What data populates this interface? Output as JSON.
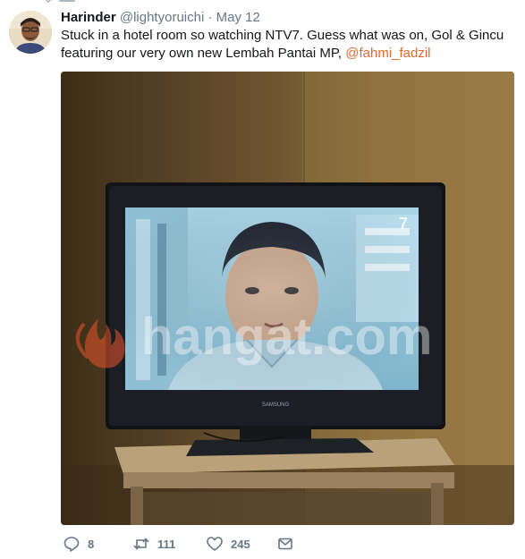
{
  "tweet": {
    "display_name": "Harinder",
    "handle": "@lightyoruichi",
    "separator": "·",
    "date": "May 12",
    "text": "Stuck in a hotel room so watching NTV7. Guess what was on, Gol & Gincu featuring our very own new Lembah Pantai MP, ",
    "mention": "@fahmi_fadzil"
  },
  "media": {
    "watermark": "hangat.com",
    "tv_brand": "SAMSUNG"
  },
  "actions": {
    "reply_count": "8",
    "retweet_count": "111",
    "like_count": "245"
  },
  "icons": {
    "reply": "reply-icon",
    "retweet": "retweet-icon",
    "like": "heart-icon",
    "dm": "envelope-icon"
  }
}
